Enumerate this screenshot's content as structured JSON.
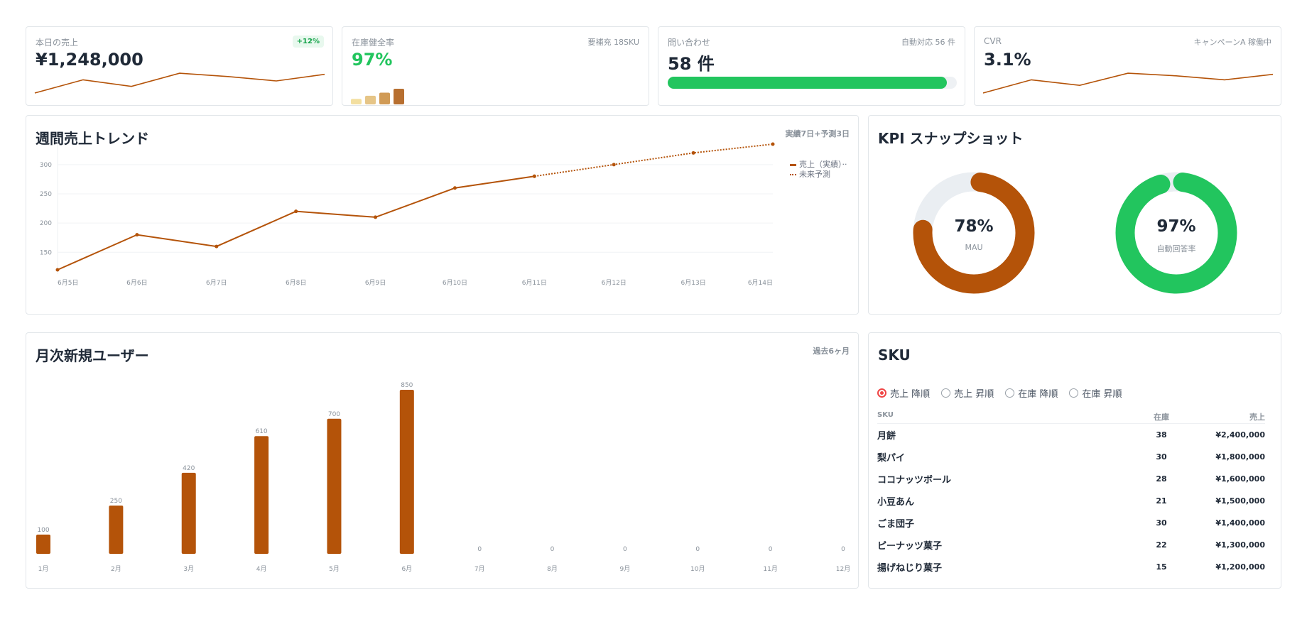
{
  "kpis": {
    "sales": {
      "label": "本日の売上",
      "value": "¥1,248,000",
      "badge": "+12%",
      "spark": [
        0,
        0.6,
        0.3,
        0.9,
        0.75,
        0.55,
        0.85
      ]
    },
    "stock": {
      "label": "在庫健全率",
      "value": "97%",
      "right": "要補充 18SKU",
      "mini_bars": [
        0.35,
        0.55,
        0.75,
        1.0
      ]
    },
    "inquiries": {
      "label": "問い合わせ",
      "value": "58 件",
      "right": "自動対応 56 件",
      "progress": 0.966
    },
    "cvr": {
      "label": "CVR",
      "value": "3.1%",
      "right": "キャンペーンA 稼働中",
      "spark": [
        0,
        0.6,
        0.35,
        0.9,
        0.78,
        0.6,
        0.85
      ]
    }
  },
  "weekly": {
    "title": "週間売上トレンド",
    "note": "実績7日+予測3日",
    "legend_actual": "売上（実績）··",
    "legend_forecast": "未来予測"
  },
  "kpi_snapshot": {
    "title": "KPI スナップショット",
    "donuts": [
      {
        "value": "78%",
        "label": "MAU",
        "fraction": 0.78,
        "color": "#b45309"
      },
      {
        "value": "97%",
        "label": "自動回答率",
        "fraction": 0.97,
        "color": "#22c55e"
      }
    ]
  },
  "monthly": {
    "title": "月次新規ユーザー",
    "note": "過去6ヶ月"
  },
  "sku": {
    "title": "SKU",
    "sort_options": [
      "売上 降順",
      "売上 昇順",
      "在庫 降順",
      "在庫 昇順"
    ],
    "selected_sort": 0,
    "columns": [
      "SKU",
      "在庫",
      "売上"
    ],
    "rows": [
      {
        "name": "月餅",
        "stock": "38",
        "sales": "¥2,400,000"
      },
      {
        "name": "梨パイ",
        "stock": "30",
        "sales": "¥1,800,000"
      },
      {
        "name": "ココナッツボール",
        "stock": "28",
        "sales": "¥1,600,000"
      },
      {
        "name": "小豆あん",
        "stock": "21",
        "sales": "¥1,500,000"
      },
      {
        "name": "ごま団子",
        "stock": "30",
        "sales": "¥1,400,000"
      },
      {
        "name": "ピーナッツ菓子",
        "stock": "22",
        "sales": "¥1,300,000"
      },
      {
        "name": "揚げねじり菓子",
        "stock": "15",
        "sales": "¥1,200,000"
      }
    ]
  },
  "colors": {
    "accent": "#b45309",
    "green": "#22c55e",
    "grid": "#f1f3f5",
    "muted": "#8a929b"
  },
  "chart_data": [
    {
      "type": "line",
      "title": "週間売上トレンド",
      "x": [
        "6月5日",
        "6月6日",
        "6月7日",
        "6月8日",
        "6月9日",
        "6月10日",
        "6月11日",
        "6月12日",
        "6月13日",
        "6月14日"
      ],
      "yticks": [
        150,
        200,
        250,
        300
      ],
      "ylim": [
        120,
        335
      ],
      "series": [
        {
          "name": "売上（実績）··",
          "style": "solid",
          "values": [
            120,
            180,
            160,
            220,
            210,
            260,
            280,
            null,
            null,
            null
          ]
        },
        {
          "name": "未来予測",
          "style": "dotted",
          "values": [
            null,
            null,
            null,
            null,
            null,
            null,
            280,
            300,
            320,
            335
          ]
        }
      ],
      "grid": true,
      "legend": "top-right"
    },
    {
      "type": "bar",
      "title": "月次新規ユーザー",
      "categories": [
        "1月",
        "2月",
        "3月",
        "4月",
        "5月",
        "6月",
        "7月",
        "8月",
        "9月",
        "10月",
        "11月",
        "12月"
      ],
      "values": [
        100,
        250,
        420,
        610,
        700,
        850,
        0,
        0,
        0,
        0,
        0,
        0
      ],
      "ylim": [
        0,
        850
      ]
    }
  ]
}
